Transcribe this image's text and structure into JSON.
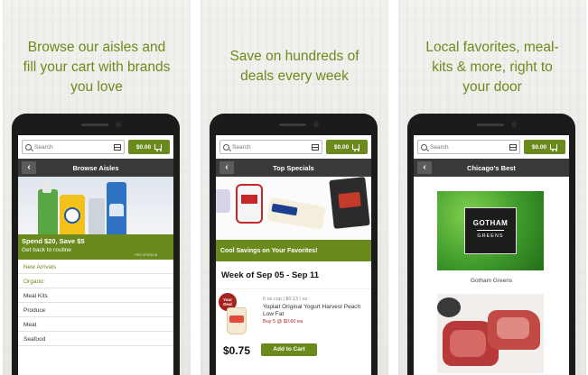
{
  "panels": [
    {
      "caption": "Browse our aisles and\nfill your cart with brands\nyou love",
      "search_placeholder": "Search",
      "cart_total": "$0.00",
      "screen_title": "Browse Aisles",
      "promo": {
        "title": "Spend $20, Save $5",
        "subtitle": "Get back to routine",
        "code": "PRO SP2010-B"
      },
      "aisles": [
        "New Arrivals",
        "Organic",
        "Meal Kits",
        "Produce",
        "Meat",
        "Seafood"
      ]
    },
    {
      "caption": "Save on hundreds of\ndeals every week",
      "search_placeholder": "Search",
      "cart_total": "$0.00",
      "screen_title": "Top Specials",
      "banner": "Cool Savings on Your Favorites!",
      "week": "Week of Sep 05 - Sep 11",
      "deal": {
        "badge": "Your Deal",
        "size": "6 oz cup | $0.13 / oz",
        "name": "Yoplait Original Yogurt Harvest Peach Low Fat",
        "offer": "Buy 5 @ $0.60 ea",
        "price": "$0.75",
        "button": "Add to Cart"
      }
    },
    {
      "caption": "Local favorites, meal-\nkits & more, right to\nyour door",
      "search_placeholder": "Search",
      "cart_total": "$0.00",
      "screen_title": "Chicago's Best",
      "tiles": [
        {
          "label": "Gotham Greens",
          "logo_top": "GOTHAM",
          "logo_bottom": "GREENS"
        },
        {
          "label": "",
          "logo_top": "",
          "logo_bottom": ""
        }
      ]
    }
  ],
  "colors": {
    "brand_green": "#6a8a1e",
    "title_bar": "#3a3a3a",
    "deal_red": "#a8221d"
  }
}
